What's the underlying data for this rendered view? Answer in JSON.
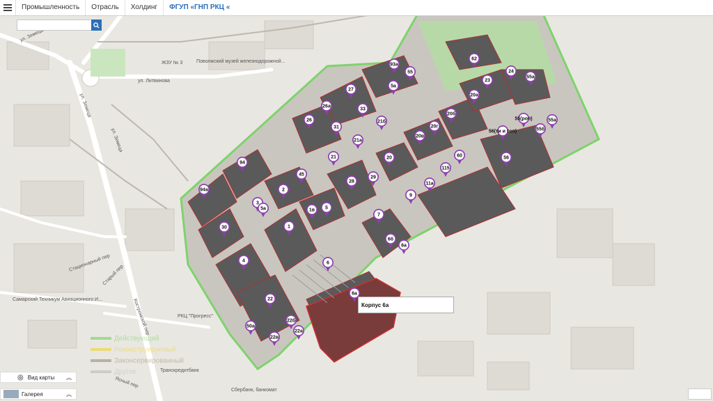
{
  "nav": {
    "items": [
      "Промышленность",
      "Отрасль",
      "Холдинг",
      "ФГУП «ГНП РКЦ «"
    ]
  },
  "search": {
    "placeholder": "",
    "button_icon": "search-icon"
  },
  "map": {
    "labels": {
      "street_zemetsa_1": "ул. Земеца",
      "street_zemetsa_2": "ул. Земеца",
      "street_zemetsa_3": "ул. Земеца",
      "street_litvinova": "ул. Литвинова",
      "street_stacionarny": "Стационарный пер",
      "street_stary": "Старый пер",
      "street_kostroma": "Костромской пер",
      "zhzu": "ЖЗУ № 3",
      "museum": "Поволжский музей железнодорожной...",
      "technikum": "Самарский Техникум Авиационного И...",
      "rkc": "РКЦ \"Прогресс\"",
      "transcredit": "Транскредитбанк",
      "sberbank": "Сбербанк, банкомат",
      "yasny": "Ясный пер"
    },
    "pins": [
      "93а",
      "55",
      "5а",
      "62",
      "24",
      "55а",
      "23",
      "27",
      "20а",
      "26а",
      "33",
      "21б",
      "20б",
      "26",
      "31",
      "21а",
      "20г",
      "20в",
      "55(роп)",
      "55а",
      "56(ти и топ)",
      "55б",
      "21",
      "20",
      "60",
      "56",
      "94",
      "45",
      "115",
      "11а",
      "9",
      "29",
      "28",
      "94а",
      "2",
      "3",
      "5а",
      "1в",
      "5",
      "7",
      "30",
      "1",
      "6б",
      "6а",
      "4",
      "6",
      "6а",
      "22",
      "22б",
      "50а",
      "22а",
      "22в"
    ],
    "selected_building": "Корпус 6а"
  },
  "legend": [
    {
      "label": "Действующий",
      "color": "#7ed36b"
    },
    {
      "label": "Реконструируемый",
      "color": "#f0d23a"
    },
    {
      "label": "Законсервированный",
      "color": "#9a9a7a"
    },
    {
      "label": "Другое",
      "color": "#bdbdbd"
    }
  ],
  "panels": {
    "map_type": "Вид карты",
    "gallery": "Галерея"
  }
}
